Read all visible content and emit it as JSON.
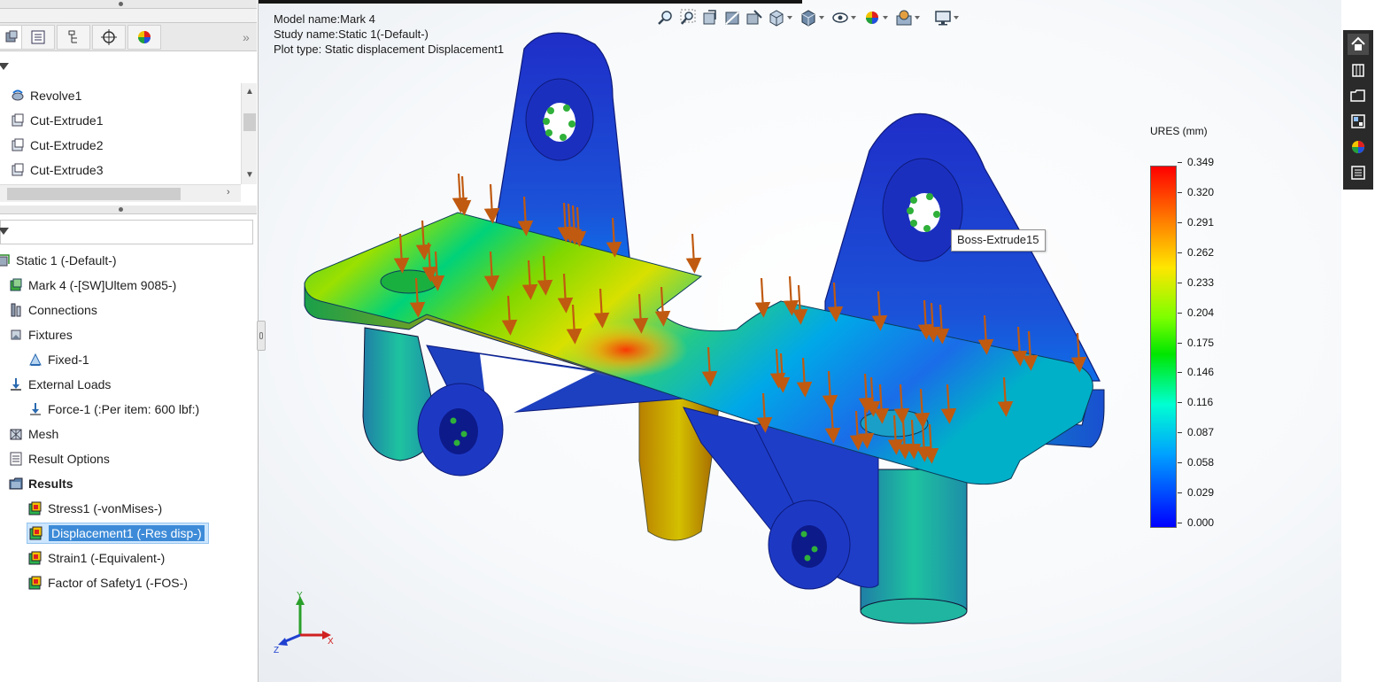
{
  "feature_tree": {
    "items": [
      {
        "label": "Revolve1",
        "icon": "revolve-icon"
      },
      {
        "label": "Cut-Extrude1",
        "icon": "cut-extrude-icon"
      },
      {
        "label": "Cut-Extrude2",
        "icon": "cut-extrude-icon"
      },
      {
        "label": "Cut-Extrude3",
        "icon": "cut-extrude-icon"
      }
    ]
  },
  "panel_tabs": [
    "feature-manager-icon",
    "property-manager-icon",
    "configuration-manager-icon",
    "dimxpert-icon",
    "display-manager-icon"
  ],
  "study_tree": {
    "study": "Static 1 (-Default-)",
    "part": "Mark 4 (-[SW]Ultem 9085-)",
    "connections": "Connections",
    "fixtures": "Fixtures",
    "fixed": "Fixed-1",
    "external_loads": "External Loads",
    "force": "Force-1 (:Per item: 600 lbf:)",
    "mesh": "Mesh",
    "result_options": "Result Options",
    "results": "Results",
    "stress": "Stress1 (-vonMises-)",
    "displacement": "Displacement1 (-Res disp-)",
    "strain": "Strain1 (-Equivalent-)",
    "fos": "Factor of Safety1 (-FOS-)"
  },
  "plot_info": {
    "model_name": "Model name:Mark 4",
    "study_name": "Study name:Static 1(-Default-)",
    "plot_type": "Plot type: Static displacement Displacement1"
  },
  "tooltip": "Boss-Extrude15",
  "legend": {
    "title": "URES (mm)",
    "values": [
      "0.349",
      "0.320",
      "0.291",
      "0.262",
      "0.233",
      "0.204",
      "0.175",
      "0.146",
      "0.116",
      "0.087",
      "0.058",
      "0.029",
      "0.000"
    ],
    "max": 0.349,
    "min": 0.0,
    "colors": [
      "#ff0000",
      "#ff7d00",
      "#ffe600",
      "#7cff00",
      "#00e600",
      "#00ffd2",
      "#00a0ff",
      "#0000ff"
    ]
  },
  "triad": {
    "y": "Y",
    "x": "X",
    "z": "Z"
  },
  "hud_icons": [
    "zoom-to-fit-icon",
    "zoom-to-area-icon",
    "previous-view-icon",
    "section-view-icon",
    "dynamic-annotation-icon",
    "view-orientation-icon",
    "display-style-icon",
    "hide-show-items-icon",
    "edit-appearance-icon",
    "apply-scene-icon",
    "view-settings-icon"
  ],
  "task_pane": [
    "home-icon",
    "design-library-icon",
    "file-explorer-icon",
    "view-palette-icon",
    "appearances-icon",
    "custom-properties-icon"
  ]
}
